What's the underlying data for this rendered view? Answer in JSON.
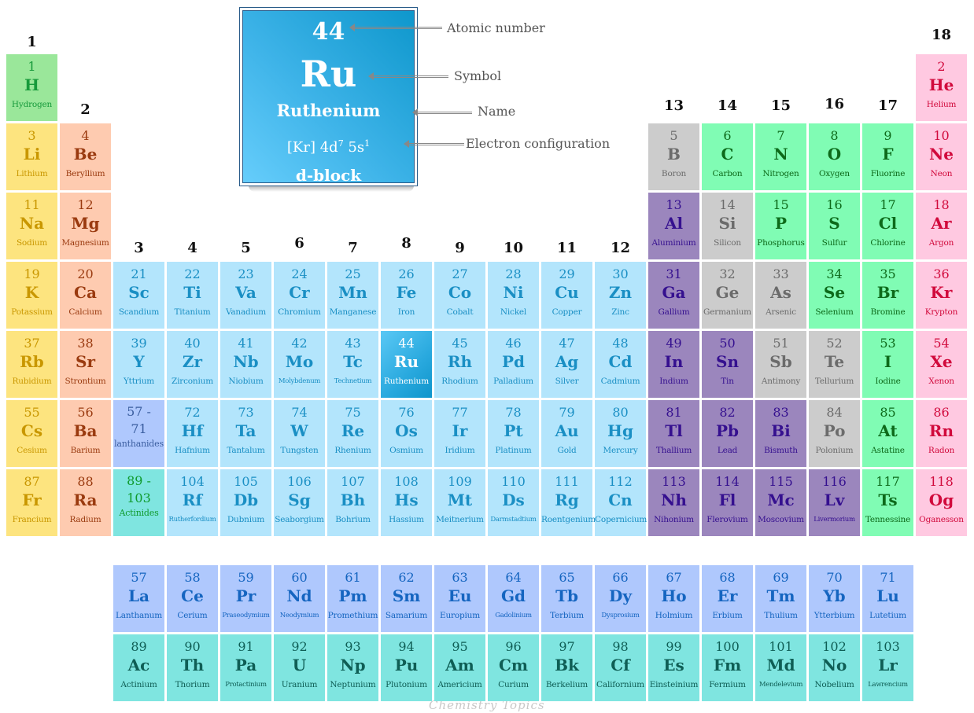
{
  "legend": {
    "atomic_number": "44",
    "symbol": "Ru",
    "name": "Ruthenium",
    "config_base": "[Kr] 4d",
    "config_sup1": "7",
    "config_mid": " 5s",
    "config_sup2": "1",
    "block": "d-block",
    "annotations": {
      "atomic_number": "Atomic number",
      "symbol": "Symbol",
      "name": "Name",
      "electron_configuration": "Electron configuration"
    }
  },
  "groups": [
    "1",
    "2",
    "3",
    "4",
    "5",
    "6",
    "7",
    "8",
    "9",
    "10",
    "11",
    "12",
    "13",
    "14",
    "15",
    "16",
    "17",
    "18"
  ],
  "category_colors": {
    "hydrogen": "#9ae79a",
    "alkali": "#fde47f",
    "alkaline": "#fecbb0",
    "transition": "#b3e5fc",
    "post": "#9b86bd",
    "metalloid": "#cccccc",
    "nonmetal": "#80fcb4",
    "noble": "#ffc9e1",
    "lanth": "#afc8fd",
    "actin": "#7fe5e0",
    "selected": "#29a9de"
  },
  "placeholders": {
    "lanthanides": {
      "range_start": "57 -",
      "range_end": "71",
      "label": "lanthanides"
    },
    "actinides": {
      "range_start": "89 -",
      "range_end": "103",
      "label": "Actinides"
    }
  },
  "elements": [
    {
      "n": "1",
      "s": "H",
      "name": "Hydrogen",
      "g": 1,
      "p": 1,
      "c": "hydrogen"
    },
    {
      "n": "2",
      "s": "He",
      "name": "Helium",
      "g": 18,
      "p": 1,
      "c": "noble"
    },
    {
      "n": "3",
      "s": "Li",
      "name": "Lithium",
      "g": 1,
      "p": 2,
      "c": "alkali"
    },
    {
      "n": "4",
      "s": "Be",
      "name": "Beryllium",
      "g": 2,
      "p": 2,
      "c": "alkaline"
    },
    {
      "n": "5",
      "s": "B",
      "name": "Boron",
      "g": 13,
      "p": 2,
      "c": "metalloid"
    },
    {
      "n": "6",
      "s": "C",
      "name": "Carbon",
      "g": 14,
      "p": 2,
      "c": "nonmetal"
    },
    {
      "n": "7",
      "s": "N",
      "name": "Nitrogen",
      "g": 15,
      "p": 2,
      "c": "nonmetal"
    },
    {
      "n": "8",
      "s": "O",
      "name": "Oxygen",
      "g": 16,
      "p": 2,
      "c": "nonmetal"
    },
    {
      "n": "9",
      "s": "F",
      "name": "Fluorine",
      "g": 17,
      "p": 2,
      "c": "nonmetal"
    },
    {
      "n": "10",
      "s": "Ne",
      "name": "Neon",
      "g": 18,
      "p": 2,
      "c": "noble"
    },
    {
      "n": "11",
      "s": "Na",
      "name": "Sodium",
      "g": 1,
      "p": 3,
      "c": "alkali"
    },
    {
      "n": "12",
      "s": "Mg",
      "name": "Magnesium",
      "g": 2,
      "p": 3,
      "c": "alkaline"
    },
    {
      "n": "13",
      "s": "Al",
      "name": "Aluminium",
      "g": 13,
      "p": 3,
      "c": "post"
    },
    {
      "n": "14",
      "s": "Si",
      "name": "Silicon",
      "g": 14,
      "p": 3,
      "c": "metalloid"
    },
    {
      "n": "15",
      "s": "P",
      "name": "Phosphorus",
      "g": 15,
      "p": 3,
      "c": "nonmetal"
    },
    {
      "n": "16",
      "s": "S",
      "name": "Sulfur",
      "g": 16,
      "p": 3,
      "c": "nonmetal"
    },
    {
      "n": "17",
      "s": "Cl",
      "name": "Chlorine",
      "g": 17,
      "p": 3,
      "c": "nonmetal"
    },
    {
      "n": "18",
      "s": "Ar",
      "name": "Argon",
      "g": 18,
      "p": 3,
      "c": "noble"
    },
    {
      "n": "19",
      "s": "K",
      "name": "Potassium",
      "g": 1,
      "p": 4,
      "c": "alkali"
    },
    {
      "n": "20",
      "s": "Ca",
      "name": "Calcium",
      "g": 2,
      "p": 4,
      "c": "alkaline"
    },
    {
      "n": "21",
      "s": "Sc",
      "name": "Scandium",
      "g": 3,
      "p": 4,
      "c": "transition"
    },
    {
      "n": "22",
      "s": "Ti",
      "name": "Titanium",
      "g": 4,
      "p": 4,
      "c": "transition"
    },
    {
      "n": "23",
      "s": "Va",
      "name": "Vanadium",
      "g": 5,
      "p": 4,
      "c": "transition"
    },
    {
      "n": "24",
      "s": "Cr",
      "name": "Chromium",
      "g": 6,
      "p": 4,
      "c": "transition"
    },
    {
      "n": "25",
      "s": "Mn",
      "name": "Manganese",
      "g": 7,
      "p": 4,
      "c": "transition"
    },
    {
      "n": "26",
      "s": "Fe",
      "name": "Iron",
      "g": 8,
      "p": 4,
      "c": "transition"
    },
    {
      "n": "27",
      "s": "Co",
      "name": "Cobalt",
      "g": 9,
      "p": 4,
      "c": "transition"
    },
    {
      "n": "28",
      "s": "Ni",
      "name": "Nickel",
      "g": 10,
      "p": 4,
      "c": "transition"
    },
    {
      "n": "29",
      "s": "Cu",
      "name": "Copper",
      "g": 11,
      "p": 4,
      "c": "transition"
    },
    {
      "n": "30",
      "s": "Zn",
      "name": "Zinc",
      "g": 12,
      "p": 4,
      "c": "transition"
    },
    {
      "n": "31",
      "s": "Ga",
      "name": "Gallium",
      "g": 13,
      "p": 4,
      "c": "post"
    },
    {
      "n": "32",
      "s": "Ge",
      "name": "Germanium",
      "g": 14,
      "p": 4,
      "c": "metalloid"
    },
    {
      "n": "33",
      "s": "As",
      "name": "Arsenic",
      "g": 15,
      "p": 4,
      "c": "metalloid"
    },
    {
      "n": "34",
      "s": "Se",
      "name": "Selenium",
      "g": 16,
      "p": 4,
      "c": "nonmetal"
    },
    {
      "n": "35",
      "s": "Br",
      "name": "Bromine",
      "g": 17,
      "p": 4,
      "c": "nonmetal"
    },
    {
      "n": "36",
      "s": "Kr",
      "name": "Krypton",
      "g": 18,
      "p": 4,
      "c": "noble"
    },
    {
      "n": "37",
      "s": "Rb",
      "name": "Rubidium",
      "g": 1,
      "p": 5,
      "c": "alkali"
    },
    {
      "n": "38",
      "s": "Sr",
      "name": "Strontium",
      "g": 2,
      "p": 5,
      "c": "alkaline"
    },
    {
      "n": "39",
      "s": "Y",
      "name": "Yttrium",
      "g": 3,
      "p": 5,
      "c": "transition"
    },
    {
      "n": "40",
      "s": "Zr",
      "name": "Zirconium",
      "g": 4,
      "p": 5,
      "c": "transition"
    },
    {
      "n": "41",
      "s": "Nb",
      "name": "Niobium",
      "g": 5,
      "p": 5,
      "c": "transition"
    },
    {
      "n": "42",
      "s": "Mo",
      "name": "Molybdenum",
      "g": 6,
      "p": 5,
      "c": "transition",
      "small": true
    },
    {
      "n": "43",
      "s": "Tc",
      "name": "Technetium",
      "g": 7,
      "p": 5,
      "c": "transition",
      "small": true
    },
    {
      "n": "44",
      "s": "Ru",
      "name": "Ruthenium",
      "g": 8,
      "p": 5,
      "c": "selected"
    },
    {
      "n": "45",
      "s": "Rh",
      "name": "Rhodium",
      "g": 9,
      "p": 5,
      "c": "transition"
    },
    {
      "n": "46",
      "s": "Pd",
      "name": "Palladium",
      "g": 10,
      "p": 5,
      "c": "transition"
    },
    {
      "n": "47",
      "s": "Ag",
      "name": "Silver",
      "g": 11,
      "p": 5,
      "c": "transition"
    },
    {
      "n": "48",
      "s": "Cd",
      "name": "Cadmium",
      "g": 12,
      "p": 5,
      "c": "transition"
    },
    {
      "n": "49",
      "s": "In",
      "name": "Indium",
      "g": 13,
      "p": 5,
      "c": "post"
    },
    {
      "n": "50",
      "s": "Sn",
      "name": "Tin",
      "g": 14,
      "p": 5,
      "c": "post"
    },
    {
      "n": "51",
      "s": "Sb",
      "name": "Antimony",
      "g": 15,
      "p": 5,
      "c": "metalloid"
    },
    {
      "n": "52",
      "s": "Te",
      "name": "Tellurium",
      "g": 16,
      "p": 5,
      "c": "metalloid"
    },
    {
      "n": "53",
      "s": "I",
      "name": "Iodine",
      "g": 17,
      "p": 5,
      "c": "nonmetal"
    },
    {
      "n": "54",
      "s": "Xe",
      "name": "Xenon",
      "g": 18,
      "p": 5,
      "c": "noble"
    },
    {
      "n": "55",
      "s": "Cs",
      "name": "Cesium",
      "g": 1,
      "p": 6,
      "c": "alkali"
    },
    {
      "n": "56",
      "s": "Ba",
      "name": "Barium",
      "g": 2,
      "p": 6,
      "c": "alkaline"
    },
    {
      "n": "72",
      "s": "Hf",
      "name": "Hafnium",
      "g": 4,
      "p": 6,
      "c": "transition"
    },
    {
      "n": "73",
      "s": "Ta",
      "name": "Tantalum",
      "g": 5,
      "p": 6,
      "c": "transition"
    },
    {
      "n": "74",
      "s": "W",
      "name": "Tungsten",
      "g": 6,
      "p": 6,
      "c": "transition"
    },
    {
      "n": "75",
      "s": "Re",
      "name": "Rhenium",
      "g": 7,
      "p": 6,
      "c": "transition"
    },
    {
      "n": "76",
      "s": "Os",
      "name": "Osmium",
      "g": 8,
      "p": 6,
      "c": "transition"
    },
    {
      "n": "77",
      "s": "Ir",
      "name": "Iridium",
      "g": 9,
      "p": 6,
      "c": "transition"
    },
    {
      "n": "78",
      "s": "Pt",
      "name": "Platinum",
      "g": 10,
      "p": 6,
      "c": "transition"
    },
    {
      "n": "79",
      "s": "Au",
      "name": "Gold",
      "g": 11,
      "p": 6,
      "c": "transition"
    },
    {
      "n": "80",
      "s": "Hg",
      "name": "Mercury",
      "g": 12,
      "p": 6,
      "c": "transition"
    },
    {
      "n": "81",
      "s": "Tl",
      "name": "Thallium",
      "g": 13,
      "p": 6,
      "c": "post"
    },
    {
      "n": "82",
      "s": "Pb",
      "name": "Lead",
      "g": 14,
      "p": 6,
      "c": "post"
    },
    {
      "n": "83",
      "s": "Bi",
      "name": "Bismuth",
      "g": 15,
      "p": 6,
      "c": "post"
    },
    {
      "n": "84",
      "s": "Po",
      "name": "Polonium",
      "g": 16,
      "p": 6,
      "c": "metalloid"
    },
    {
      "n": "85",
      "s": "At",
      "name": "Astatine",
      "g": 17,
      "p": 6,
      "c": "nonmetal"
    },
    {
      "n": "86",
      "s": "Rn",
      "name": "Radon",
      "g": 18,
      "p": 6,
      "c": "noble"
    },
    {
      "n": "87",
      "s": "Fr",
      "name": "Francium",
      "g": 1,
      "p": 7,
      "c": "alkali"
    },
    {
      "n": "88",
      "s": "Ra",
      "name": "Radium",
      "g": 2,
      "p": 7,
      "c": "alkaline"
    },
    {
      "n": "104",
      "s": "Rf",
      "name": "Rutherfordium",
      "g": 4,
      "p": 7,
      "c": "transition",
      "small": true
    },
    {
      "n": "105",
      "s": "Db",
      "name": "Dubnium",
      "g": 5,
      "p": 7,
      "c": "transition"
    },
    {
      "n": "106",
      "s": "Sg",
      "name": "Seaborgium",
      "g": 6,
      "p": 7,
      "c": "transition"
    },
    {
      "n": "107",
      "s": "Bh",
      "name": "Bohrium",
      "g": 7,
      "p": 7,
      "c": "transition"
    },
    {
      "n": "108",
      "s": "Hs",
      "name": "Hassium",
      "g": 8,
      "p": 7,
      "c": "transition"
    },
    {
      "n": "109",
      "s": "Mt",
      "name": "Meitnerium",
      "g": 9,
      "p": 7,
      "c": "transition"
    },
    {
      "n": "110",
      "s": "Ds",
      "name": "Darmstadtium",
      "g": 10,
      "p": 7,
      "c": "transition",
      "small": true
    },
    {
      "n": "111",
      "s": "Rg",
      "name": "Roentgenium",
      "g": 11,
      "p": 7,
      "c": "transition"
    },
    {
      "n": "112",
      "s": "Cn",
      "name": "Copernicium",
      "g": 12,
      "p": 7,
      "c": "transition"
    },
    {
      "n": "113",
      "s": "Nh",
      "name": "Nihonium",
      "g": 13,
      "p": 7,
      "c": "post"
    },
    {
      "n": "114",
      "s": "Fl",
      "name": "Flerovium",
      "g": 14,
      "p": 7,
      "c": "post"
    },
    {
      "n": "115",
      "s": "Mc",
      "name": "Moscovium",
      "g": 15,
      "p": 7,
      "c": "post"
    },
    {
      "n": "116",
      "s": "Lv",
      "name": "Livermorium",
      "g": 16,
      "p": 7,
      "c": "post",
      "small": true
    },
    {
      "n": "117",
      "s": "Ts",
      "name": "Tennessine",
      "g": 17,
      "p": 7,
      "c": "nonmetal"
    },
    {
      "n": "118",
      "s": "Og",
      "name": "Oganesson",
      "g": 18,
      "p": 7,
      "c": "noble"
    }
  ],
  "lanthanides": [
    {
      "n": "57",
      "s": "La",
      "name": "Lanthanum"
    },
    {
      "n": "58",
      "s": "Ce",
      "name": "Cerium"
    },
    {
      "n": "59",
      "s": "Pr",
      "name": "Praseodymium",
      "small": true
    },
    {
      "n": "60",
      "s": "Nd",
      "name": "Neodymium",
      "small": true
    },
    {
      "n": "61",
      "s": "Pm",
      "name": "Promethium"
    },
    {
      "n": "62",
      "s": "Sm",
      "name": "Samarium"
    },
    {
      "n": "63",
      "s": "Eu",
      "name": "Europium"
    },
    {
      "n": "64",
      "s": "Gd",
      "name": "Gadolinium",
      "small": true
    },
    {
      "n": "65",
      "s": "Tb",
      "name": "Terbium"
    },
    {
      "n": "66",
      "s": "Dy",
      "name": "Dysprosium",
      "small": true
    },
    {
      "n": "67",
      "s": "Ho",
      "name": "Holmium"
    },
    {
      "n": "68",
      "s": "Er",
      "name": "Erbium"
    },
    {
      "n": "69",
      "s": "Tm",
      "name": "Thulium"
    },
    {
      "n": "70",
      "s": "Yb",
      "name": "Ytterbium"
    },
    {
      "n": "71",
      "s": "Lu",
      "name": "Lutetium"
    }
  ],
  "actinides": [
    {
      "n": "89",
      "s": "Ac",
      "name": "Actinium"
    },
    {
      "n": "90",
      "s": "Th",
      "name": "Thorium"
    },
    {
      "n": "91",
      "s": "Pa",
      "name": "Protactinium",
      "small": true
    },
    {
      "n": "92",
      "s": "U",
      "name": "Uranium"
    },
    {
      "n": "93",
      "s": "Np",
      "name": "Neptunium"
    },
    {
      "n": "94",
      "s": "Pu",
      "name": "Plutonium"
    },
    {
      "n": "95",
      "s": "Am",
      "name": "Americium"
    },
    {
      "n": "96",
      "s": "Cm",
      "name": "Curium"
    },
    {
      "n": "97",
      "s": "Bk",
      "name": "Berkelium"
    },
    {
      "n": "98",
      "s": "Cf",
      "name": "Californium"
    },
    {
      "n": "99",
      "s": "Es",
      "name": "Einsteinium"
    },
    {
      "n": "100",
      "s": "Fm",
      "name": "Fermium"
    },
    {
      "n": "101",
      "s": "Md",
      "name": "Mendelevium",
      "small": true
    },
    {
      "n": "102",
      "s": "No",
      "name": "Nobelium"
    },
    {
      "n": "103",
      "s": "Lr",
      "name": "Lawrencium",
      "small": true
    }
  ],
  "watermark": "Chemistry Topics"
}
